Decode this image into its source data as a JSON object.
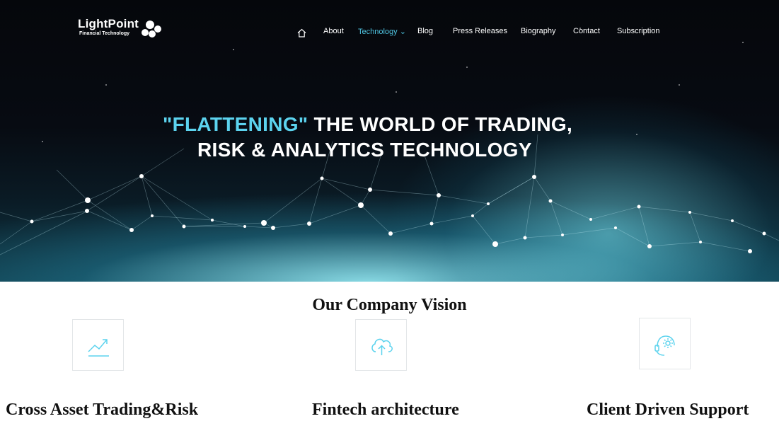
{
  "logo": {
    "title": "LightPoint",
    "subtitle": "Financial Technology"
  },
  "nav": {
    "items": [
      {
        "label": "About"
      },
      {
        "label": "Technology ⌄"
      },
      {
        "label": "Blog"
      },
      {
        "label": "Press Releases"
      },
      {
        "label": "Biography"
      },
      {
        "label": "Contact"
      },
      {
        "label": "Subscription"
      }
    ],
    "active_item": "Technology",
    "home_icon": "home-icon"
  },
  "hero": {
    "headline_accent": "\"FLATTENING\"",
    "headline_rest": " THE WORLD OF TRADING,",
    "headline_line2": "RISK & ANALYTICS  TECHNOLOGY"
  },
  "vision": {
    "title": "Our Company Vision",
    "cards": [
      {
        "title": "Cross Asset Trading&Risk",
        "icon": "trending-chart-icon"
      },
      {
        "title": "Fintech architecture",
        "icon": "cloud-upload-icon"
      },
      {
        "title": "Client Driven Support",
        "icon": "support-gear-icon"
      }
    ]
  },
  "colors": {
    "accent": "#5cd3ee",
    "nav_active": "#4fc3e0",
    "icon": "#5cd3ee"
  }
}
